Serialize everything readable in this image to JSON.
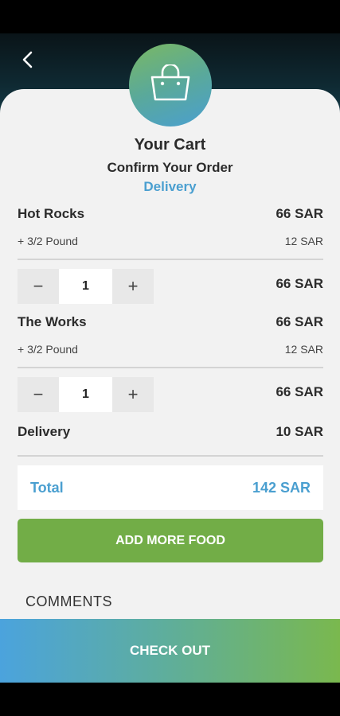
{
  "header": {
    "back_icon": "chevron-left-icon",
    "bag_icon": "shopping-bag-icon"
  },
  "cart": {
    "title": "Your Cart",
    "subtitle": "Confirm Your Order",
    "mode": "Delivery"
  },
  "items": [
    {
      "name": "Hot Rocks",
      "price": "66 SAR",
      "addon": "+ 3/2 Pound",
      "addon_price": "12 SAR",
      "minus": "−",
      "qty": "1",
      "plus": "+",
      "line_total": "66 SAR"
    },
    {
      "name": "The Works",
      "price": "66 SAR",
      "addon": "+ 3/2 Pound",
      "addon_price": "12 SAR",
      "minus": "−",
      "qty": "1",
      "plus": "+",
      "line_total": "66 SAR"
    }
  ],
  "delivery": {
    "label": "Delivery",
    "price": "10 SAR"
  },
  "total": {
    "label": "Total",
    "value": "142 SAR"
  },
  "actions": {
    "add_more": "ADD MORE FOOD",
    "comments": "COMMENTS",
    "checkout": "CHECK OUT"
  },
  "colors": {
    "accent_blue": "#4a9fd0",
    "accent_green": "#72ad47"
  }
}
